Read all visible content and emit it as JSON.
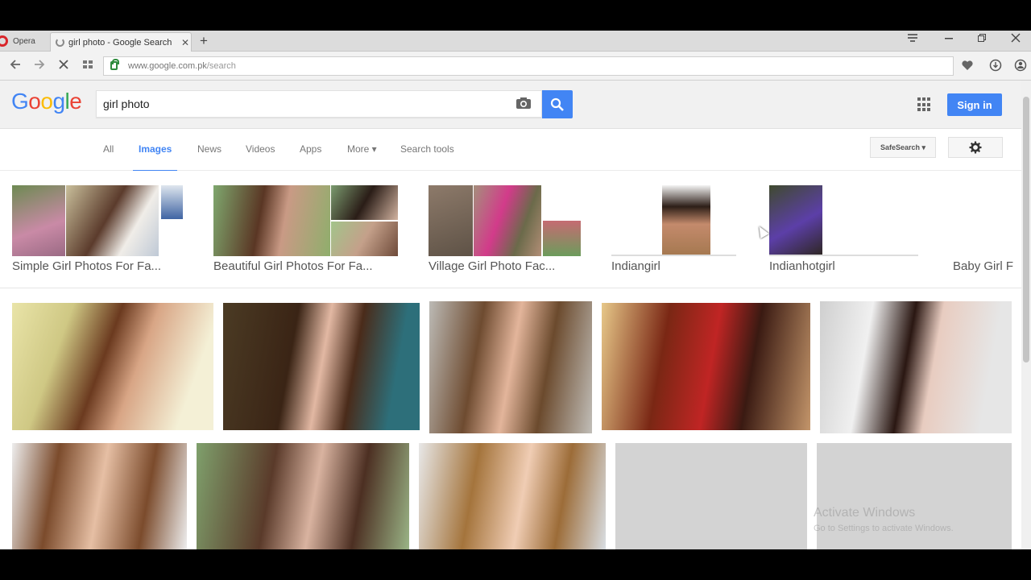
{
  "browser": {
    "opera_label": "Opera",
    "tab_title": "girl photo - Google Search",
    "tab_close": "✕",
    "new_tab": "+",
    "url_host": "www.google.com.pk",
    "url_path": "/search"
  },
  "google": {
    "logo": [
      "G",
      "o",
      "o",
      "g",
      "l",
      "e"
    ],
    "logo_colors": [
      "#4285f4",
      "#ea4335",
      "#fbbc05",
      "#4285f4",
      "#34a853",
      "#ea4335"
    ],
    "query": "girl photo",
    "sign_in": "Sign in",
    "tabs": [
      "All",
      "Images",
      "News",
      "Videos",
      "Apps",
      "More ▾",
      "Search tools"
    ],
    "safesearch": "SafeSearch ▾",
    "watermark_title": "Activate Windows",
    "watermark_sub": "Go to Settings to activate Windows."
  },
  "related": [
    {
      "caption": "Simple Girl Photos For Fa..."
    },
    {
      "caption": "Beautiful Girl Photos For Fa..."
    },
    {
      "caption": "Village Girl Photo Fac..."
    },
    {
      "caption": "Indiangirl"
    },
    {
      "caption": "Indianhotgirl"
    },
    {
      "caption": "Baby Girl F"
    }
  ],
  "colors": {
    "accent": "#4285f4",
    "placeholder_gray": "#d3d3d3"
  }
}
